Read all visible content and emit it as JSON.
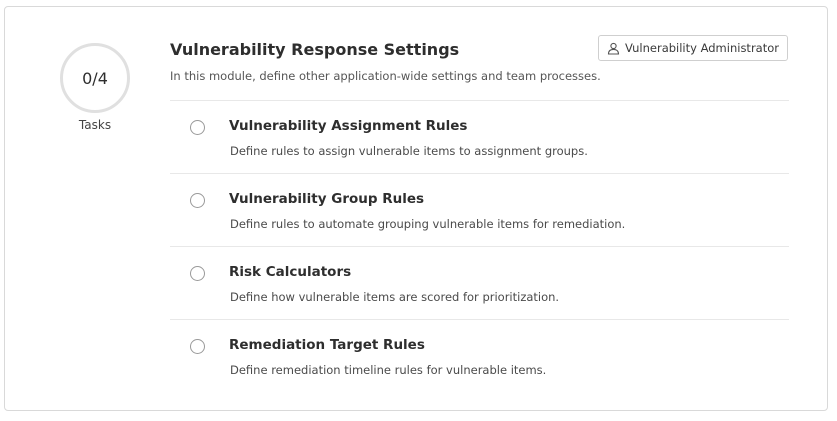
{
  "progress": {
    "value": "0/4",
    "label": "Tasks"
  },
  "header": {
    "title": "Vulnerability Response Settings",
    "subtitle": "In this module, define other application-wide settings and team processes.",
    "role_button_label": "Vulnerability Administrator",
    "role_icon": "user-icon"
  },
  "tasks": [
    {
      "title": "Vulnerability Assignment Rules",
      "description": "Define rules to assign vulnerable items to assignment groups."
    },
    {
      "title": "Vulnerability Group Rules",
      "description": "Define rules to automate grouping vulnerable items for remediation."
    },
    {
      "title": "Risk Calculators",
      "description": "Define how vulnerable items are scored for prioritization."
    },
    {
      "title": "Remediation Target Rules",
      "description": "Define remediation timeline rules for vulnerable items."
    }
  ]
}
